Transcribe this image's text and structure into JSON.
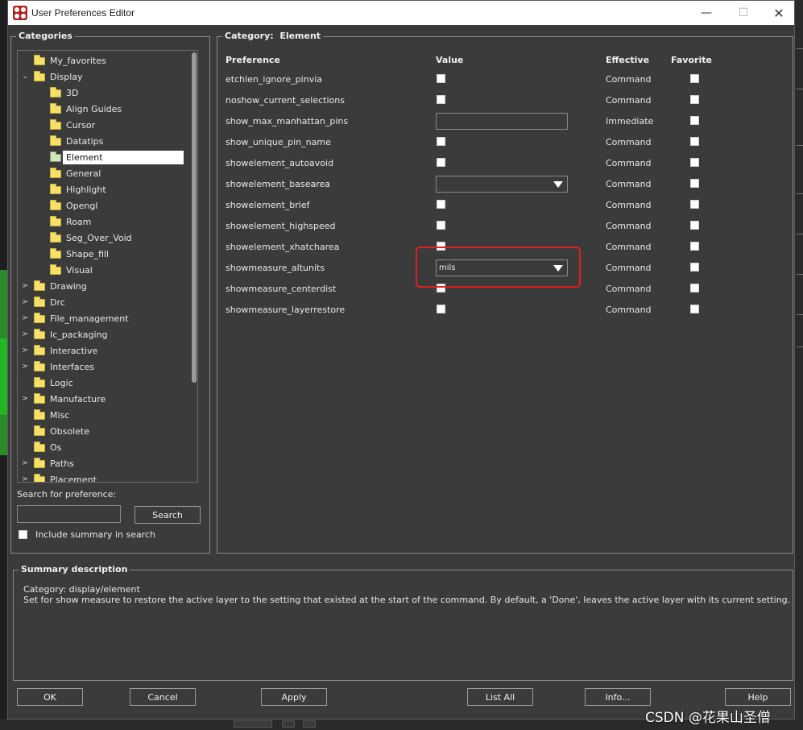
{
  "window": {
    "title": "User Preferences Editor"
  },
  "categories": {
    "title": "Categories",
    "items": [
      {
        "label": "My_favorites",
        "level": 1,
        "expander": ""
      },
      {
        "label": "Display",
        "level": 1,
        "expander": "⌄"
      },
      {
        "label": "3D",
        "level": 2,
        "expander": ""
      },
      {
        "label": "Align Guides",
        "level": 2,
        "expander": ""
      },
      {
        "label": "Cursor",
        "level": 2,
        "expander": ""
      },
      {
        "label": "Datatips",
        "level": 2,
        "expander": ""
      },
      {
        "label": "Element",
        "level": 2,
        "expander": "",
        "selected": true
      },
      {
        "label": "General",
        "level": 2,
        "expander": ""
      },
      {
        "label": "Highlight",
        "level": 2,
        "expander": ""
      },
      {
        "label": "Opengl",
        "level": 2,
        "expander": ""
      },
      {
        "label": "Roam",
        "level": 2,
        "expander": ""
      },
      {
        "label": "Seg_Over_Void",
        "level": 2,
        "expander": ""
      },
      {
        "label": "Shape_fill",
        "level": 2,
        "expander": ""
      },
      {
        "label": "Visual",
        "level": 2,
        "expander": ""
      },
      {
        "label": "Drawing",
        "level": 1,
        "expander": ">"
      },
      {
        "label": "Drc",
        "level": 1,
        "expander": ">"
      },
      {
        "label": "File_management",
        "level": 1,
        "expander": ">"
      },
      {
        "label": "Ic_packaging",
        "level": 1,
        "expander": ">"
      },
      {
        "label": "Interactive",
        "level": 1,
        "expander": ">"
      },
      {
        "label": "Interfaces",
        "level": 1,
        "expander": ">"
      },
      {
        "label": "Logic",
        "level": 1,
        "expander": ""
      },
      {
        "label": "Manufacture",
        "level": 1,
        "expander": ">"
      },
      {
        "label": "Misc",
        "level": 1,
        "expander": ""
      },
      {
        "label": "Obsolete",
        "level": 1,
        "expander": ""
      },
      {
        "label": "Os",
        "level": 1,
        "expander": ""
      },
      {
        "label": "Paths",
        "level": 1,
        "expander": ">"
      },
      {
        "label": "Placement",
        "level": 1,
        "expander": ">"
      }
    ],
    "search_label": "Search for preference:",
    "search_value": "",
    "search_button": "Search",
    "include_summary_label": "Include summary in search"
  },
  "category_panel": {
    "title_prefix": "Category:",
    "title_value": "Element",
    "columns": {
      "preference": "Preference",
      "value": "Value",
      "effective": "Effective",
      "favorite": "Favorite"
    },
    "rows": [
      {
        "name": "etchlen_ignore_pinvia",
        "type": "checkbox",
        "effective": "Command"
      },
      {
        "name": "noshow_current_selections",
        "type": "checkbox",
        "effective": "Command"
      },
      {
        "name": "show_max_manhattan_pins",
        "type": "text",
        "value": "",
        "effective": "Immediate"
      },
      {
        "name": "show_unique_pin_name",
        "type": "checkbox",
        "effective": "Command"
      },
      {
        "name": "showelement_autoavoid",
        "type": "checkbox",
        "effective": "Command"
      },
      {
        "name": "showelement_basearea",
        "type": "combo",
        "value": "",
        "effective": "Command"
      },
      {
        "name": "showelement_brief",
        "type": "checkbox",
        "effective": "Command"
      },
      {
        "name": "showelement_highspeed",
        "type": "checkbox",
        "effective": "Command"
      },
      {
        "name": "showelement_xhatcharea",
        "type": "checkbox",
        "effective": "Command"
      },
      {
        "name": "showmeasure_altunits",
        "type": "combo",
        "value": "mils",
        "effective": "Command"
      },
      {
        "name": "showmeasure_centerdist",
        "type": "checkbox",
        "effective": "Command"
      },
      {
        "name": "showmeasure_layerrestore",
        "type": "checkbox",
        "effective": "Command"
      }
    ]
  },
  "summary": {
    "title": "Summary description",
    "line1": "Category: display/element",
    "line2": "Set for show measure to restore the active layer to the setting that existed at the start of the command. By default, a 'Done', leaves the active layer with its current setting."
  },
  "buttons": {
    "ok": "OK",
    "cancel": "Cancel",
    "apply": "Apply",
    "list_all": "List All",
    "info": "Info...",
    "help": "Help"
  },
  "watermark": "CSDN @花果山圣僧",
  "colors": {
    "highlight": "#e02020",
    "folder": "#f5e06a",
    "folder_open": "#cfe8b8"
  }
}
